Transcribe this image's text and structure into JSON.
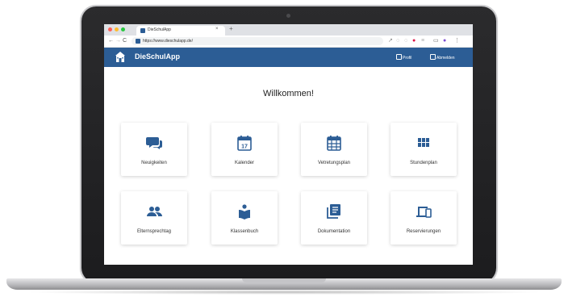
{
  "browser": {
    "tab_title": "DieSchulApp",
    "tab_close": "×",
    "new_tab": "+",
    "url": "https://www.dieschulapp.de/",
    "nav_back": "←",
    "nav_forward": "→",
    "nav_reload": "C"
  },
  "app": {
    "title": "DieSchulApp",
    "profile_label": "Profil",
    "logout_label": "Abmelden",
    "brand_color": "#2c5d95"
  },
  "main": {
    "welcome": "Willkommen!",
    "calendar_day": "17",
    "cards": [
      {
        "label": "Neuigkeiten",
        "icon": "chat-icon"
      },
      {
        "label": "Kalender",
        "icon": "calendar-icon"
      },
      {
        "label": "Vetretungsplan",
        "icon": "grid-calendar-icon"
      },
      {
        "label": "Stundenplan",
        "icon": "modules-icon"
      },
      {
        "label": "Elternsprechtag",
        "icon": "people-icon"
      },
      {
        "label": "Klassenbuch",
        "icon": "reading-icon"
      },
      {
        "label": "Dokumentation",
        "icon": "documents-icon"
      },
      {
        "label": "Reservierungen",
        "icon": "devices-icon"
      }
    ]
  }
}
